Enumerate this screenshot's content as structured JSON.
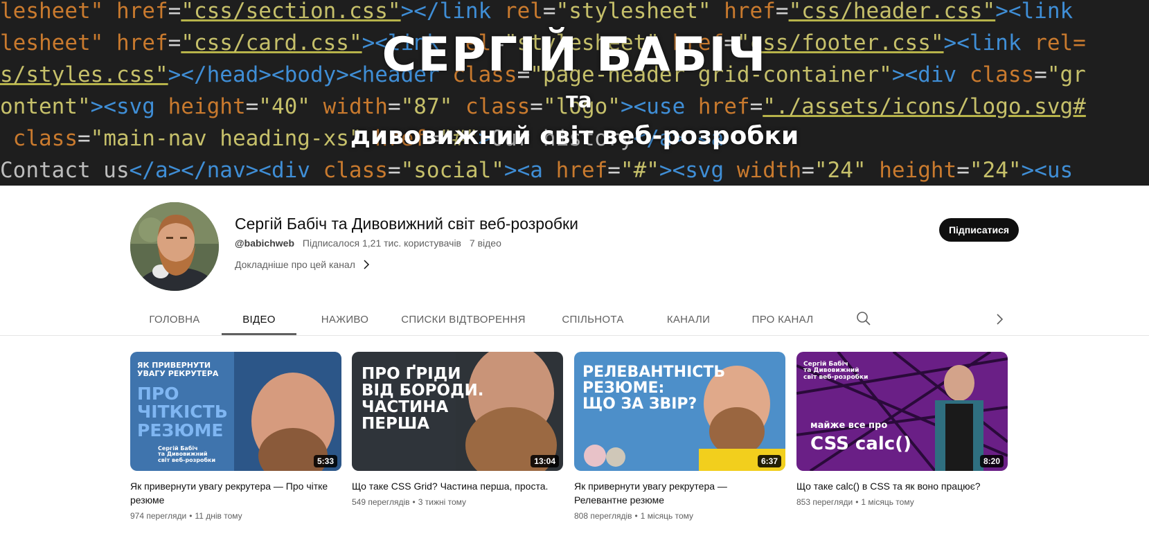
{
  "banner": {
    "code_lines": [
      [
        [
          "c-attr",
          "lesheet\" "
        ],
        [
          "c-attr",
          "href"
        ],
        [
          "c-eq",
          "="
        ],
        [
          "c-url",
          "\"css/section.css\""
        ],
        [
          "c-tag",
          "></"
        ],
        [
          "c-tag",
          "link "
        ],
        [
          "c-attr",
          "rel"
        ],
        [
          "c-eq",
          "="
        ],
        [
          "c-str",
          "\"stylesheet\" "
        ],
        [
          "c-attr",
          "href"
        ],
        [
          "c-eq",
          "="
        ],
        [
          "c-url",
          "\"css/header.css\""
        ],
        [
          "c-tag",
          "><link"
        ]
      ],
      [
        [
          "c-attr",
          "lesheet\" "
        ],
        [
          "c-attr",
          "href"
        ],
        [
          "c-eq",
          "="
        ],
        [
          "c-url",
          "\"css/card.css\""
        ],
        [
          "c-tag",
          "><link "
        ],
        [
          "c-attr",
          "rel"
        ],
        [
          "c-eq",
          "="
        ],
        [
          "c-str",
          "\"stylesheet\" "
        ],
        [
          "c-attr",
          "href"
        ],
        [
          "c-eq",
          "="
        ],
        [
          "c-url",
          "\"css/footer.css\""
        ],
        [
          "c-tag",
          "><link "
        ],
        [
          "c-attr",
          "rel="
        ]
      ],
      [
        [
          "c-url",
          "s/styles.css\""
        ],
        [
          "c-tag",
          "></head><body><header "
        ],
        [
          "c-attr",
          "class"
        ],
        [
          "c-eq",
          "="
        ],
        [
          "c-str",
          "\"page-header grid-container\""
        ],
        [
          "c-tag",
          "><div "
        ],
        [
          "c-attr",
          "class"
        ],
        [
          "c-eq",
          "="
        ],
        [
          "c-str",
          "\"gr"
        ]
      ],
      [
        [
          "c-str",
          "ontent\""
        ],
        [
          "c-tag",
          "><svg "
        ],
        [
          "c-attr",
          "height"
        ],
        [
          "c-eq",
          "="
        ],
        [
          "c-str",
          "\"40\" "
        ],
        [
          "c-attr",
          "width"
        ],
        [
          "c-eq",
          "="
        ],
        [
          "c-str",
          "\"87\" "
        ],
        [
          "c-attr",
          "class"
        ],
        [
          "c-eq",
          "="
        ],
        [
          "c-str",
          "\"logo\""
        ],
        [
          "c-tag",
          "><use "
        ],
        [
          "c-attr",
          "href"
        ],
        [
          "c-eq",
          "="
        ],
        [
          "c-url",
          "\"./assets/icons/logo.svg#"
        ]
      ],
      [
        [
          "c-attr",
          " class"
        ],
        [
          "c-eq",
          "="
        ],
        [
          "c-str",
          "\"main-nav heading-xs\" "
        ],
        [
          "c-attr",
          "href"
        ],
        [
          "c-eq",
          "="
        ],
        [
          "c-str",
          "\"#\""
        ],
        [
          "c-tag",
          ">"
        ],
        [
          "c-txt",
          "Our history"
        ],
        [
          "c-tag",
          "</a> <a"
        ]
      ],
      [
        [
          "c-txt",
          "Contact us"
        ],
        [
          "c-tag",
          "</a></nav><div "
        ],
        [
          "c-attr",
          "class"
        ],
        [
          "c-eq",
          "="
        ],
        [
          "c-str",
          "\"social\""
        ],
        [
          "c-tag",
          "><a "
        ],
        [
          "c-attr",
          "href"
        ],
        [
          "c-eq",
          "="
        ],
        [
          "c-str",
          "\"#\""
        ],
        [
          "c-tag",
          "><svg "
        ],
        [
          "c-attr",
          "width"
        ],
        [
          "c-eq",
          "="
        ],
        [
          "c-str",
          "\"24\" "
        ],
        [
          "c-attr",
          "height"
        ],
        [
          "c-eq",
          "="
        ],
        [
          "c-str",
          "\"24\""
        ],
        [
          "c-tag",
          "><us"
        ]
      ]
    ],
    "title": "СЕРГІЙ БАБІЧ",
    "connector": "та",
    "subtitle": "дивовижний світ веб-розробки"
  },
  "channel": {
    "name": "Сергій Бабіч та Дивовижний світ веб-розробки",
    "handle": "@babichweb",
    "subscribers": "Підписалося 1,21 тис. користувачів",
    "video_count": "7 відео",
    "more_label": "Докладніше про цей канал",
    "subscribe_label": "Підписатися"
  },
  "tabs": [
    {
      "label": "ГОЛОВНА",
      "active": false
    },
    {
      "label": "ВІДЕО",
      "active": true
    },
    {
      "label": "НАЖИВО",
      "active": false
    },
    {
      "label": "СПИСКИ ВІДТВОРЕННЯ",
      "active": false
    },
    {
      "label": "СПІЛЬНОТА",
      "active": false
    },
    {
      "label": "КАНАЛИ",
      "active": false
    },
    {
      "label": "ПРО КАНАЛ",
      "active": false
    }
  ],
  "videos": [
    {
      "title": "Як привернути увагу рекрутера — Про чітке резюме",
      "views": "974 перегляди",
      "age": "11 днів тому",
      "duration": "5:33",
      "thumb_top": "ЯК ПРИВЕРНУТИ\nУВАГУ РЕКРУТЕРА",
      "thumb_main": "ПРО\nЧІТКІСТЬ\nРЕЗЮМЕ",
      "thumb_brand": "Сергій Бабіч\nта Дивовижний\nсвіт веб-розробки"
    },
    {
      "title": "Що таке CSS Grid? Частина перша, проста.",
      "views": "549 переглядів",
      "age": "3 тижні тому",
      "duration": "13:04",
      "thumb_main": "ПРО ҐРІДИ\nВІД БОРОДИ.\nЧАСТИНА\nПЕРША"
    },
    {
      "title": "Як привернути увагу рекрутера — Релевантне резюме",
      "views": "808 переглядів",
      "age": "1 місяць тому",
      "duration": "6:37",
      "thumb_main": "РЕЛЕВАНТНІСТЬ\nРЕЗЮМЕ:\nЩО ЗА ЗВІР?"
    },
    {
      "title": "Що таке calc() в CSS та як воно працює?",
      "views": "853 перегляди",
      "age": "1 місяць тому",
      "duration": "8:20",
      "thumb_brand": "Сергій Бабіч\nта Дивовижний\nсвіт веб-розробки",
      "thumb_top": "майже все про",
      "thumb_main": "CSS calc()"
    }
  ]
}
